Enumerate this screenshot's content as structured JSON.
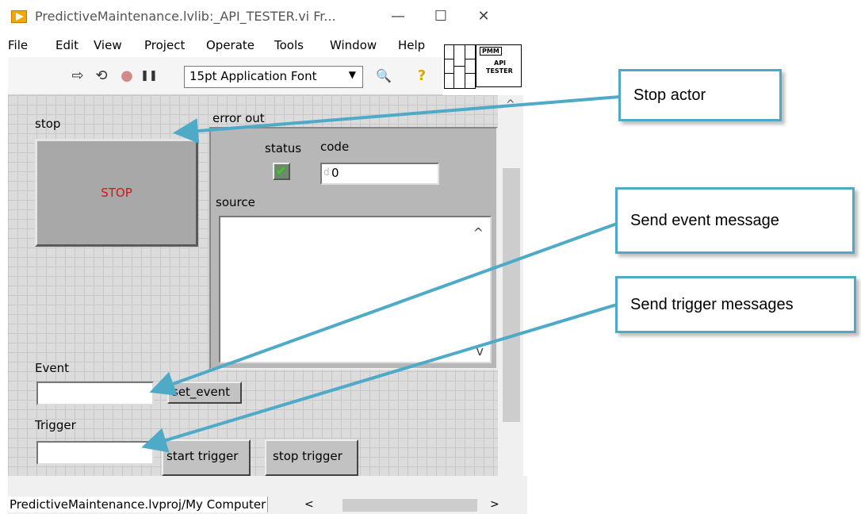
{
  "window": {
    "title": "PredictiveMaintenance.lvlib:_API_TESTER.vi Fr...",
    "minimize": "—",
    "maximize": "☐",
    "close": "✕"
  },
  "menu": [
    "File",
    "Edit",
    "View",
    "Project",
    "Operate",
    "Tools",
    "Window",
    "Help"
  ],
  "toolbar": {
    "run": "⇨",
    "run_continuous": "⟲",
    "abort": "●",
    "pause": "❚❚",
    "font": "15pt Application Font",
    "font_arrow": "▼",
    "search": "🔍",
    "help": "?"
  },
  "vi_icon": {
    "line1": "PMM",
    "line2": "API",
    "line3": "TESTER"
  },
  "panel": {
    "stop_label": "stop",
    "stop_button": "STOP",
    "error_out_label": "error out",
    "status_label": "status",
    "status_check": "✔",
    "code_label": "code",
    "code_prefix": "d",
    "code_value": "0",
    "source_label": "source",
    "scroll_up": "^",
    "scroll_down": "v",
    "event_label": "Event",
    "set_event_button": "set_event",
    "trigger_label": "Trigger",
    "start_trigger_button": "start trigger",
    "stop_trigger_button": "stop trigger"
  },
  "statusbar": {
    "path": "PredictiveMaintenance.lvproj/My Computer",
    "scroll_left": "<",
    "scroll_right": ">"
  },
  "callouts": {
    "stop_actor": "Stop actor",
    "send_event": "Send event message",
    "send_trigger": "Send trigger messages"
  },
  "colors": {
    "callout_border": "#4eaac7",
    "stop_text": "#e01010",
    "status_ok": "#39d11a"
  }
}
